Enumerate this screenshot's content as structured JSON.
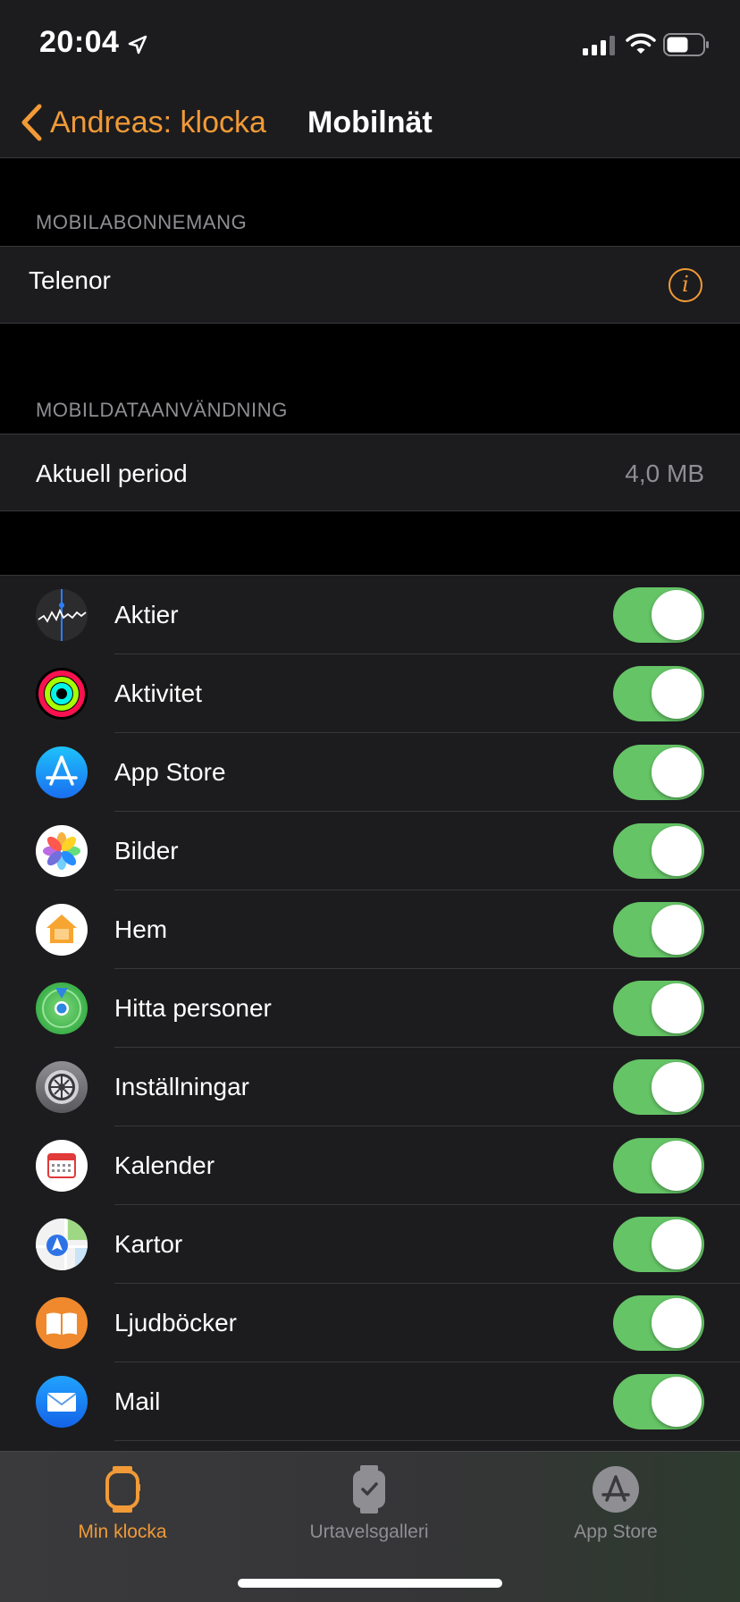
{
  "status_bar": {
    "time": "20:04"
  },
  "nav": {
    "back_label": "Andreas: klocka",
    "title": "Mobilnät"
  },
  "sections": {
    "subscription_header": "MOBILABONNEMANG",
    "carrier": "Telenor",
    "data_usage_header": "MOBILDATAANVÄNDNING",
    "current_period_label": "Aktuell period",
    "current_period_value": "4,0 MB"
  },
  "apps": [
    {
      "name": "Aktier",
      "icon": "stocks-icon",
      "enabled": true
    },
    {
      "name": "Aktivitet",
      "icon": "activity-icon",
      "enabled": true
    },
    {
      "name": "App Store",
      "icon": "app-store-icon",
      "enabled": true
    },
    {
      "name": "Bilder",
      "icon": "photos-icon",
      "enabled": true
    },
    {
      "name": "Hem",
      "icon": "home-icon",
      "enabled": true
    },
    {
      "name": "Hitta personer",
      "icon": "find-people-icon",
      "enabled": true
    },
    {
      "name": "Inställningar",
      "icon": "settings-icon",
      "enabled": true
    },
    {
      "name": "Kalender",
      "icon": "calendar-icon",
      "enabled": true
    },
    {
      "name": "Kartor",
      "icon": "maps-icon",
      "enabled": true
    },
    {
      "name": "Ljudböcker",
      "icon": "audiobooks-icon",
      "enabled": true
    },
    {
      "name": "Mail",
      "icon": "mail-icon",
      "enabled": true
    }
  ],
  "tabs": [
    {
      "label": "Min klocka",
      "icon": "watch-icon",
      "active": true
    },
    {
      "label": "Urtavelsgalleri",
      "icon": "face-gallery-icon",
      "active": false
    },
    {
      "label": "App Store",
      "icon": "app-store-tab-icon",
      "active": false
    }
  ],
  "colors": {
    "accent": "#f19a37",
    "toggle_on": "#65c466",
    "background": "#000000",
    "cell": "#1c1c1e",
    "inactive_tab": "#8e8e93"
  }
}
